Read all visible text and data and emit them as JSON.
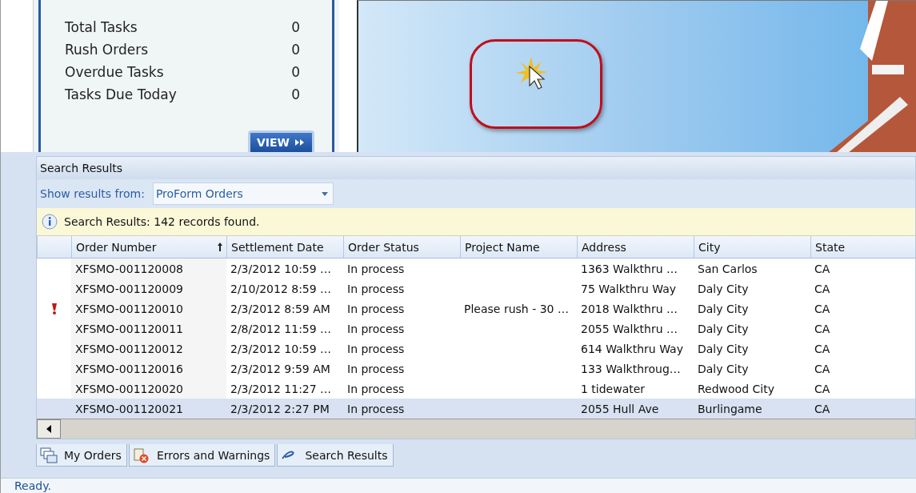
{
  "summary": {
    "stats": [
      {
        "label": "Total Tasks",
        "value": "0"
      },
      {
        "label": "Rush Orders",
        "value": "0"
      },
      {
        "label": "Overdue Tasks",
        "value": "0"
      },
      {
        "label": "Tasks Due Today",
        "value": "0"
      }
    ],
    "view_button": "VIEW"
  },
  "search_results": {
    "title": "Search Results",
    "filter_label": "Show results from:",
    "filter_value": "ProForm Orders",
    "info": "Search Results: 142 records found.",
    "columns": [
      {
        "label": "Order Number",
        "sorted": true
      },
      {
        "label": "Settlement Date",
        "sorted": false
      },
      {
        "label": "Order Status",
        "sorted": false
      },
      {
        "label": "Project Name",
        "sorted": false
      },
      {
        "label": "Address",
        "sorted": false
      },
      {
        "label": "City",
        "sorted": false
      },
      {
        "label": "State",
        "sorted": false
      }
    ],
    "rows": [
      {
        "rush": false,
        "selected": false,
        "cells": [
          "XFSMO-001120008",
          "2/3/2012 10:59 …",
          "In process",
          "",
          "1363 Walkthru …",
          "San Carlos",
          "CA"
        ]
      },
      {
        "rush": false,
        "selected": false,
        "cells": [
          "XFSMO-001120009",
          "2/10/2012 8:59 …",
          "In process",
          "",
          "75 Walkthru Way",
          "Daly City",
          "CA"
        ]
      },
      {
        "rush": true,
        "selected": false,
        "cells": [
          "XFSMO-001120010",
          "2/3/2012 8:59 AM",
          "In process",
          "Please rush - 30 …",
          "2018 Walkthru …",
          "Daly City",
          "CA"
        ]
      },
      {
        "rush": false,
        "selected": false,
        "cells": [
          "XFSMO-001120011",
          "2/8/2012 11:59 …",
          "In process",
          "",
          "2055 Walkthru …",
          "Daly City",
          "CA"
        ]
      },
      {
        "rush": false,
        "selected": false,
        "cells": [
          "XFSMO-001120012",
          "2/3/2012 10:59 …",
          "In process",
          "",
          "614 Walkthru Way",
          "Daly City",
          "CA"
        ]
      },
      {
        "rush": false,
        "selected": false,
        "cells": [
          "XFSMO-001120016",
          "2/3/2012 9:59 AM",
          "In process",
          "",
          "133 Walkthroug…",
          "Daly City",
          "CA"
        ]
      },
      {
        "rush": false,
        "selected": false,
        "cells": [
          "XFSMO-001120020",
          "2/3/2012 11:27 …",
          "In process",
          "",
          "1 tidewater",
          "Redwood City",
          "CA"
        ]
      },
      {
        "rush": false,
        "selected": true,
        "cells": [
          "XFSMO-001120021",
          "2/3/2012 2:27 PM",
          "In process",
          "",
          "2055 Hull Ave",
          "Burlingame",
          "CA"
        ]
      }
    ]
  },
  "bottom_tabs": [
    {
      "kind": "orders",
      "label": "My Orders",
      "selected": false
    },
    {
      "kind": "errors",
      "label": "Errors and Warnings",
      "selected": false
    },
    {
      "kind": "search",
      "label": "Search Results",
      "selected": false
    }
  ],
  "status_bar": "Ready."
}
